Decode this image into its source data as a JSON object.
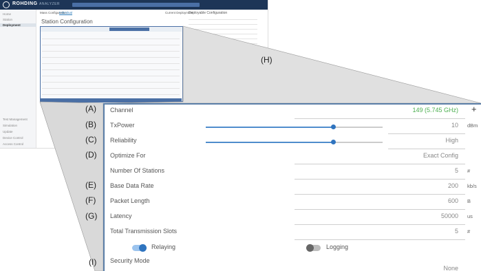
{
  "app": {
    "brand": "ROHDING",
    "brand_sub": "ANALYZER",
    "progress_label": "0%"
  },
  "sidebar": {
    "items": [
      {
        "label": "Home"
      },
      {
        "label": "Station"
      },
      {
        "label": "Deployment"
      },
      {
        "label": "Test Management"
      },
      {
        "label": "Simulation"
      },
      {
        "label": "Update"
      },
      {
        "label": "Device Control"
      },
      {
        "label": "Access Control"
      }
    ]
  },
  "tabs": [
    {
      "label": "Mass Configuration"
    },
    {
      "label": "Individual"
    },
    {
      "label": "Current Deployment"
    }
  ],
  "page_title": "Station Configuration",
  "right_panel": {
    "title": "Deployable Configuration",
    "encoding_title": "Encountering Tables"
  },
  "callouts": [
    "(A)",
    "(B)",
    "(C)",
    "(D)",
    "(E)",
    "(F)",
    "(G)",
    "(H)",
    "(I)"
  ],
  "fields": {
    "channel": {
      "label": "Channel",
      "value": "149 (5.745 GHz)",
      "plus": "+"
    },
    "tx_power": {
      "label": "TxPower",
      "value": "10",
      "unit": "dBm",
      "level": 0.72
    },
    "reliability": {
      "label": "Reliability",
      "value": "High",
      "level": 0.72
    },
    "optimize_for": {
      "label": "Optimize For",
      "value": "Exact Config"
    },
    "num_stations": {
      "label": "Number Of Stations",
      "value": "5",
      "unit": "#"
    },
    "base_rate": {
      "label": "Base Data Rate",
      "value": "200",
      "unit": "kb/s"
    },
    "packet_length": {
      "label": "Packet Length",
      "value": "600",
      "unit": "B"
    },
    "latency": {
      "label": "Latency",
      "value": "50000",
      "unit": "us"
    },
    "slots": {
      "label": "Total Transmission Slots",
      "value": "5",
      "unit": "#"
    },
    "relaying": {
      "label": "Relaying",
      "on": true
    },
    "logging": {
      "label": "Logging",
      "on": false
    },
    "security_mode": {
      "label": "Security Mode",
      "value": "None"
    }
  },
  "colors": {
    "accent": "#2f74bf",
    "highlight": "#4caf50",
    "frame": "#5a7ea8"
  }
}
